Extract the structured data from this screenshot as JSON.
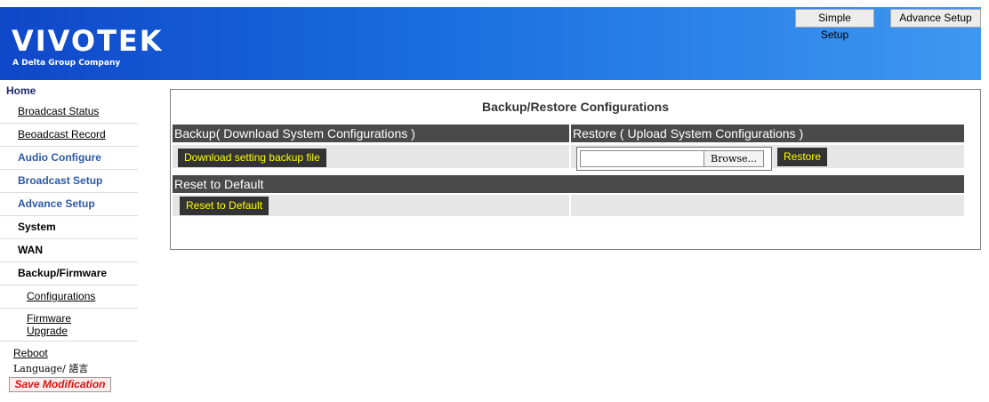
{
  "header": {
    "logo_text": "VIVOTEK",
    "logo_subtitle": "A Delta Group Company",
    "simple_setup": "Simple Setup",
    "advance_setup": "Advance Setup"
  },
  "sidebar": {
    "home": "Home",
    "items": [
      {
        "label": "Broadcast Status"
      },
      {
        "label": "Beoadcast Record"
      },
      {
        "label": "Audio Configure"
      },
      {
        "label": "Broadcast Setup"
      },
      {
        "label": "Advance Setup"
      },
      {
        "label": "System"
      },
      {
        "label": "WAN"
      },
      {
        "label": "Backup/Firmware"
      },
      {
        "label": "Configurations"
      },
      {
        "label": "Firmware Upgrade"
      }
    ],
    "reboot": "Reboot",
    "language": "Language/ 語言",
    "save_modification": "Save Modification"
  },
  "main": {
    "title": "Backup/Restore Configurations",
    "backup_header": "Backup( Download System Configurations )",
    "restore_header": "Restore ( Upload System Configurations )",
    "download_button": "Download setting backup file",
    "file_value": "",
    "browse_button": "Browse...",
    "restore_button": "Restore",
    "reset_header": "Reset to Default",
    "reset_button": "Reset to Default"
  },
  "colors": {
    "header_start": "#0f47c9",
    "header_end": "#3f98f0",
    "section_header": "#4a4a4a",
    "button_bg": "#333333",
    "button_text": "#ffff00",
    "nav_blue": "#2e5aa8",
    "save_red": "#e01010"
  }
}
